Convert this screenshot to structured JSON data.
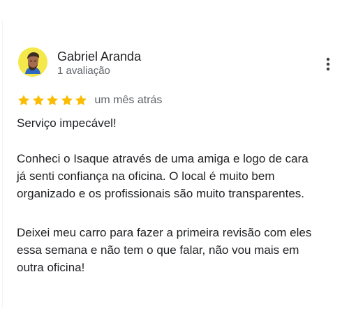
{
  "review": {
    "author": {
      "name": "Gabriel Aranda",
      "meta": "1 avaliação",
      "avatar_icon": "avatar-person-icon",
      "avatar_bg": "#f5e84a"
    },
    "menu_icon": "more-vert-icon",
    "rating": {
      "value": 5,
      "max": 5,
      "star_color": "#fbbc04",
      "star_icon": "star-icon"
    },
    "date": "um mês atrás",
    "text_lines": [
      "Serviço impecável!",
      "Conheci o Isaque através de uma amiga e logo de cara",
      "já senti confiança na oficina. O local é muito bem",
      "organizado e os profissionais são muito transparentes.",
      "Deixei meu carro para fazer a primeira revisão com eles",
      "essa semana e não tem o que falar, não vou mais em",
      "outra oficina!"
    ]
  }
}
